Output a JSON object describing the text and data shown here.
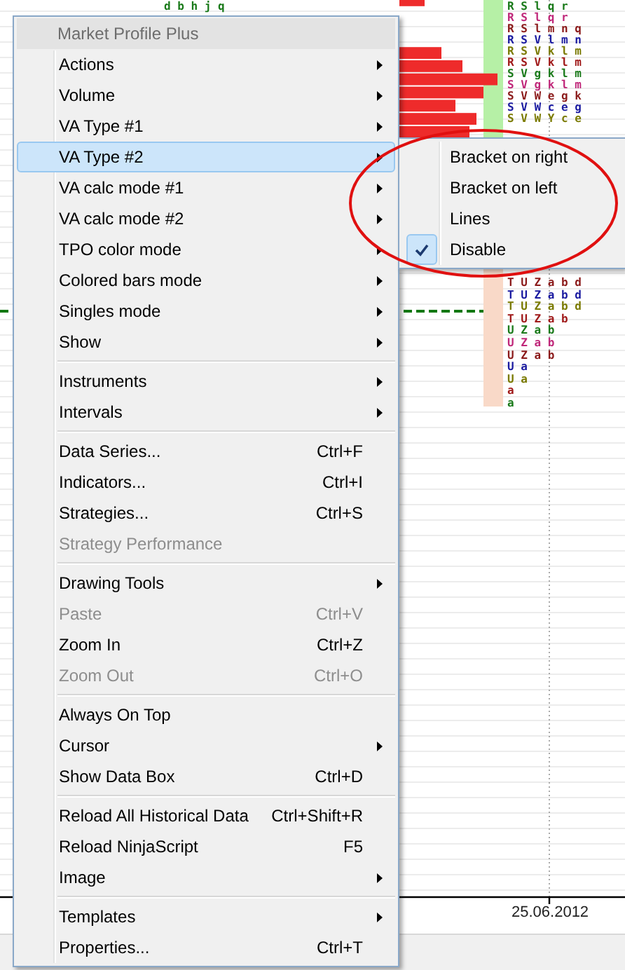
{
  "chart": {
    "top_letters": "d b h j q",
    "profile_top": [
      "R S l q r",
      "R S l q r",
      "R S l m n q",
      "R S V l m n",
      "R S V k l m",
      "R S V k l m",
      "S V g k l m",
      "S V g k l m",
      "S V W e g k",
      "S V W c e g",
      "S V W Y c e"
    ],
    "profile_bottom": [
      "T U Z a b d",
      "T U Z a b d",
      "T U Z a b d",
      "T U Z a b",
      "U Z a b",
      "U Z a b",
      "U Z a b",
      "U a",
      "U a",
      "a",
      "a"
    ],
    "date_label": "25.06.2012"
  },
  "menu": {
    "items": [
      {
        "kind": "header",
        "label": "Market Profile Plus"
      },
      {
        "kind": "item",
        "label": "Actions",
        "submenu": true,
        "disabled": false,
        "selected": false
      },
      {
        "kind": "item",
        "label": "Volume",
        "submenu": true,
        "disabled": false,
        "selected": false
      },
      {
        "kind": "item",
        "label": "VA Type #1",
        "submenu": true,
        "disabled": false,
        "selected": false
      },
      {
        "kind": "item",
        "label": "VA Type #2",
        "submenu": true,
        "disabled": false,
        "selected": true
      },
      {
        "kind": "item",
        "label": "VA calc mode #1",
        "submenu": true,
        "disabled": false,
        "selected": false
      },
      {
        "kind": "item",
        "label": "VA calc mode #2",
        "submenu": true,
        "disabled": false,
        "selected": false
      },
      {
        "kind": "item",
        "label": "TPO color mode",
        "submenu": true,
        "disabled": false,
        "selected": false
      },
      {
        "kind": "item",
        "label": "Colored bars mode",
        "submenu": true,
        "disabled": false,
        "selected": false
      },
      {
        "kind": "item",
        "label": "Singles mode",
        "submenu": true,
        "disabled": false,
        "selected": false
      },
      {
        "kind": "item",
        "label": "Show",
        "submenu": true,
        "disabled": false,
        "selected": false
      },
      {
        "kind": "separator"
      },
      {
        "kind": "item",
        "label": "Instruments",
        "submenu": true,
        "disabled": false,
        "selected": false
      },
      {
        "kind": "item",
        "label": "Intervals",
        "submenu": true,
        "disabled": false,
        "selected": false
      },
      {
        "kind": "separator"
      },
      {
        "kind": "item",
        "label": "Data Series...",
        "shortcut": "Ctrl+F",
        "submenu": false,
        "disabled": false,
        "selected": false
      },
      {
        "kind": "item",
        "label": "Indicators...",
        "shortcut": "Ctrl+I",
        "submenu": false,
        "disabled": false,
        "selected": false
      },
      {
        "kind": "item",
        "label": "Strategies...",
        "shortcut": "Ctrl+S",
        "submenu": false,
        "disabled": false,
        "selected": false
      },
      {
        "kind": "item",
        "label": "Strategy Performance",
        "submenu": false,
        "disabled": true,
        "selected": false
      },
      {
        "kind": "separator"
      },
      {
        "kind": "item",
        "label": "Drawing Tools",
        "submenu": true,
        "disabled": false,
        "selected": false
      },
      {
        "kind": "item",
        "label": "Paste",
        "shortcut": "Ctrl+V",
        "submenu": false,
        "disabled": true,
        "selected": false
      },
      {
        "kind": "item",
        "label": "Zoom In",
        "shortcut": "Ctrl+Z",
        "submenu": false,
        "disabled": false,
        "selected": false
      },
      {
        "kind": "item",
        "label": "Zoom Out",
        "shortcut": "Ctrl+O",
        "submenu": false,
        "disabled": true,
        "selected": false
      },
      {
        "kind": "separator"
      },
      {
        "kind": "item",
        "label": "Always On Top",
        "submenu": false,
        "disabled": false,
        "selected": false
      },
      {
        "kind": "item",
        "label": "Cursor",
        "submenu": true,
        "disabled": false,
        "selected": false
      },
      {
        "kind": "item",
        "label": "Show Data Box",
        "shortcut": "Ctrl+D",
        "submenu": false,
        "disabled": false,
        "selected": false
      },
      {
        "kind": "separator"
      },
      {
        "kind": "item",
        "label": "Reload All Historical Data",
        "shortcut": "Ctrl+Shift+R",
        "submenu": false,
        "disabled": false,
        "selected": false
      },
      {
        "kind": "item",
        "label": "Reload NinjaScript",
        "shortcut": "F5",
        "submenu": false,
        "disabled": false,
        "selected": false
      },
      {
        "kind": "item",
        "label": "Image",
        "submenu": true,
        "disabled": false,
        "selected": false
      },
      {
        "kind": "separator"
      },
      {
        "kind": "item",
        "label": "Templates",
        "submenu": true,
        "disabled": false,
        "selected": false
      },
      {
        "kind": "item",
        "label": "Properties...",
        "shortcut": "Ctrl+T",
        "submenu": false,
        "disabled": false,
        "selected": false
      }
    ]
  },
  "submenu": {
    "items": [
      {
        "label": "Bracket on right",
        "checked": false
      },
      {
        "label": "Bracket on left",
        "checked": false
      },
      {
        "label": "Lines",
        "checked": false
      },
      {
        "label": "Disable",
        "checked": true
      }
    ]
  }
}
